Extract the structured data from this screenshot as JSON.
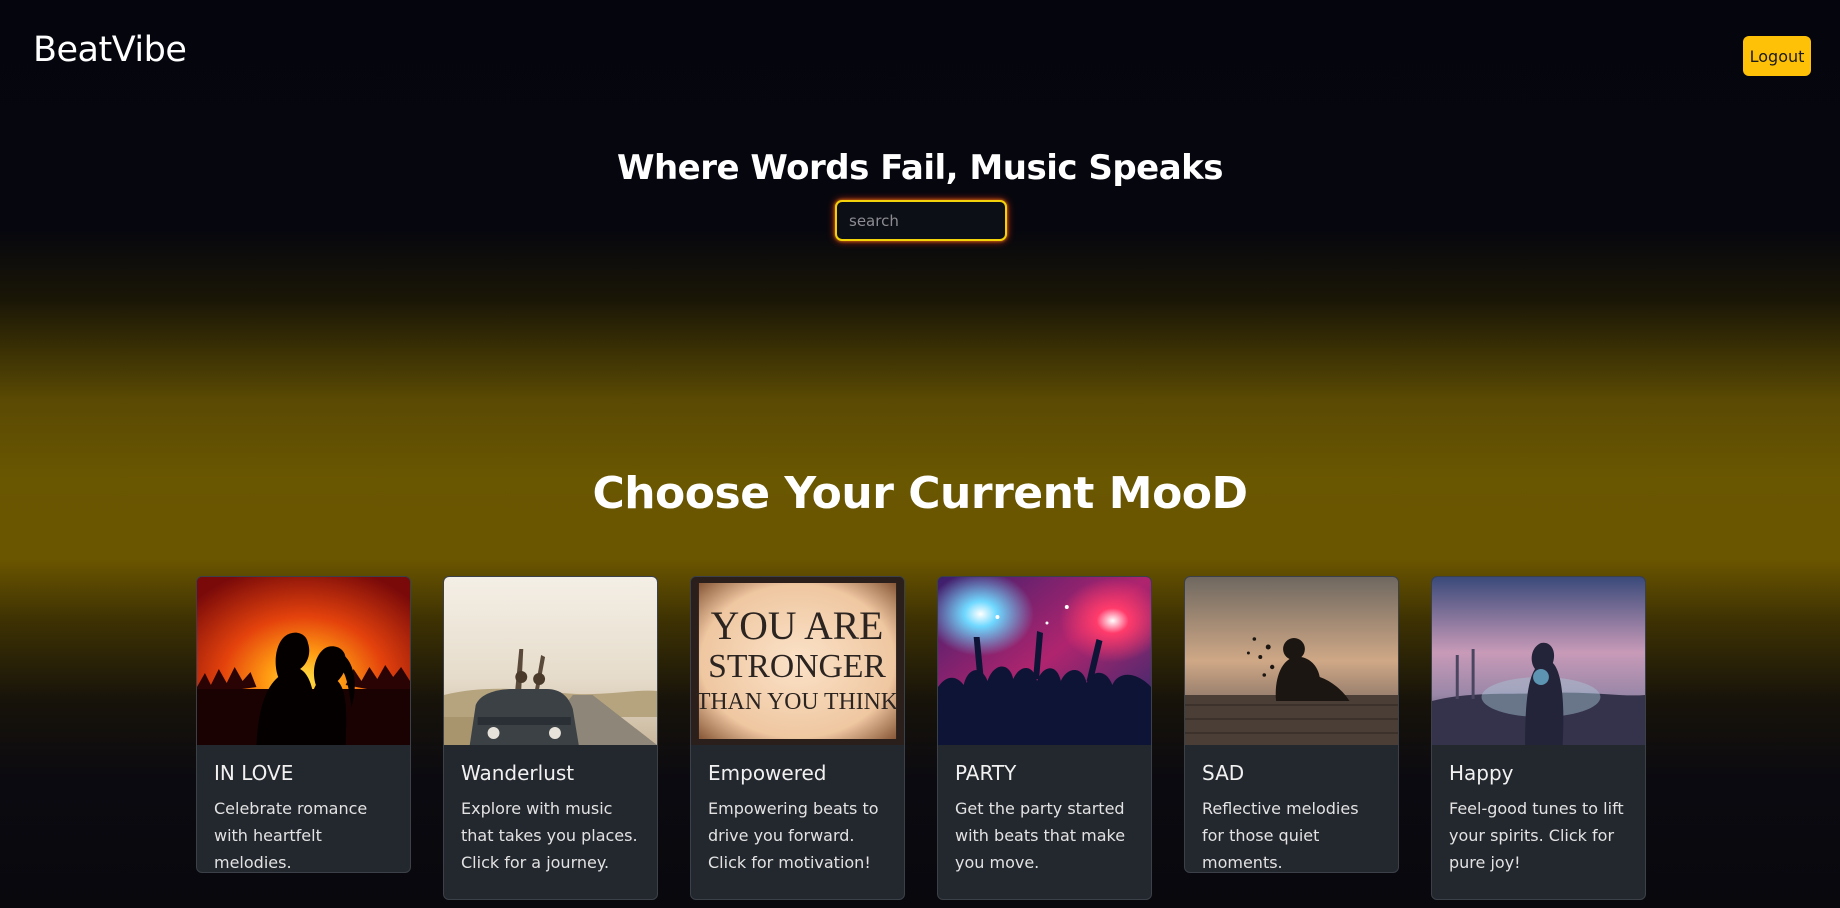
{
  "header": {
    "brand": "BeatVibe",
    "logout_label": "Logout"
  },
  "hero": {
    "title": "Where Words Fail, Music Speaks",
    "search_placeholder": "search"
  },
  "moods": {
    "title": "Choose Your Current MooD",
    "cards": [
      {
        "title": "IN LOVE",
        "text": "Celebrate romance with heartfelt melodies."
      },
      {
        "title": "Wanderlust",
        "text": "Explore with music that takes you places. Click for a journey."
      },
      {
        "title": "Empowered",
        "text": "Empowering beats to drive you forward. Click for motivation!",
        "image_text": [
          "YOU ARE",
          "STRONGER",
          "THAN YOU THINK"
        ]
      },
      {
        "title": "PARTY",
        "text": "Get the party started with beats that make you move."
      },
      {
        "title": "SAD",
        "text": "Reflective melodies for those quiet moments."
      },
      {
        "title": "Happy",
        "text": "Feel-good tunes to lift your spirits. Click for pure joy!"
      }
    ]
  },
  "colors": {
    "accent": "#ffc107",
    "card_bg": "#23272e"
  }
}
